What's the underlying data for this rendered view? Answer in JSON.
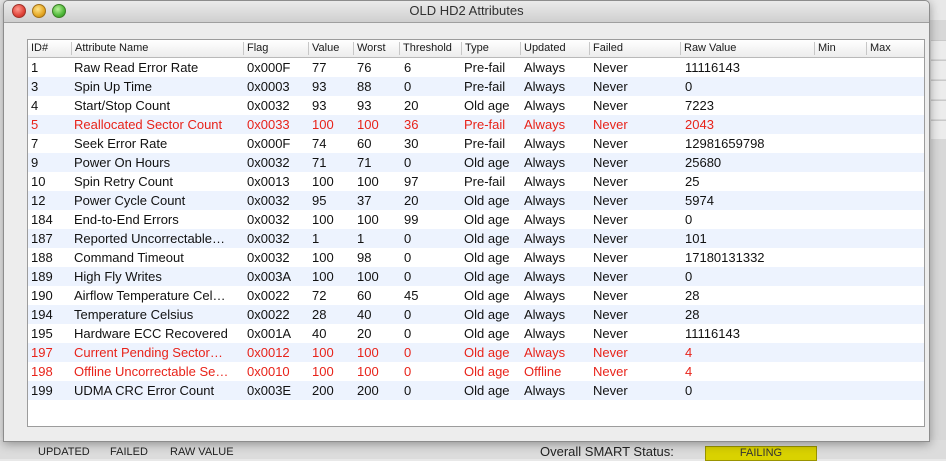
{
  "window": {
    "title": "OLD HD2 Attributes"
  },
  "columns": [
    "ID#",
    "Attribute Name",
    "Flag",
    "Value",
    "Worst",
    "Threshold",
    "Type",
    "Updated",
    "Failed",
    "Raw Value",
    "Min",
    "Max"
  ],
  "rows": [
    {
      "id": "1",
      "name": "Raw Read Error Rate",
      "flag": "0x000F",
      "value": "77",
      "worst": "76",
      "threshold": "6",
      "type": "Pre-fail",
      "updated": "Always",
      "failed": "Never",
      "raw": "11116143",
      "warn": false
    },
    {
      "id": "3",
      "name": "Spin Up Time",
      "flag": "0x0003",
      "value": "93",
      "worst": "88",
      "threshold": "0",
      "type": "Pre-fail",
      "updated": "Always",
      "failed": "Never",
      "raw": "0",
      "warn": false
    },
    {
      "id": "4",
      "name": "Start/Stop Count",
      "flag": "0x0032",
      "value": "93",
      "worst": "93",
      "threshold": "20",
      "type": "Old age",
      "updated": "Always",
      "failed": "Never",
      "raw": "7223",
      "warn": false
    },
    {
      "id": "5",
      "name": "Reallocated Sector Count",
      "flag": "0x0033",
      "value": "100",
      "worst": "100",
      "threshold": "36",
      "type": "Pre-fail",
      "updated": "Always",
      "failed": "Never",
      "raw": "2043",
      "warn": true
    },
    {
      "id": "7",
      "name": "Seek Error Rate",
      "flag": "0x000F",
      "value": "74",
      "worst": "60",
      "threshold": "30",
      "type": "Pre-fail",
      "updated": "Always",
      "failed": "Never",
      "raw": "12981659798",
      "warn": false
    },
    {
      "id": "9",
      "name": "Power On Hours",
      "flag": "0x0032",
      "value": "71",
      "worst": "71",
      "threshold": "0",
      "type": "Old age",
      "updated": "Always",
      "failed": "Never",
      "raw": "25680",
      "warn": false
    },
    {
      "id": "10",
      "name": "Spin Retry Count",
      "flag": "0x0013",
      "value": "100",
      "worst": "100",
      "threshold": "97",
      "type": "Pre-fail",
      "updated": "Always",
      "failed": "Never",
      "raw": "25",
      "warn": false
    },
    {
      "id": "12",
      "name": "Power Cycle Count",
      "flag": "0x0032",
      "value": "95",
      "worst": "37",
      "threshold": "20",
      "type": "Old age",
      "updated": "Always",
      "failed": "Never",
      "raw": "5974",
      "warn": false
    },
    {
      "id": "184",
      "name": "End-to-End Errors",
      "flag": "0x0032",
      "value": "100",
      "worst": "100",
      "threshold": "99",
      "type": "Old age",
      "updated": "Always",
      "failed": "Never",
      "raw": "0",
      "warn": false
    },
    {
      "id": "187",
      "name": "Reported Uncorrectable…",
      "flag": "0x0032",
      "value": "1",
      "worst": "1",
      "threshold": "0",
      "type": "Old age",
      "updated": "Always",
      "failed": "Never",
      "raw": "101",
      "warn": false
    },
    {
      "id": "188",
      "name": "Command Timeout",
      "flag": "0x0032",
      "value": "100",
      "worst": "98",
      "threshold": "0",
      "type": "Old age",
      "updated": "Always",
      "failed": "Never",
      "raw": "17180131332",
      "warn": false
    },
    {
      "id": "189",
      "name": "High Fly Writes",
      "flag": "0x003A",
      "value": "100",
      "worst": "100",
      "threshold": "0",
      "type": "Old age",
      "updated": "Always",
      "failed": "Never",
      "raw": "0",
      "warn": false
    },
    {
      "id": "190",
      "name": "Airflow Temperature Cel…",
      "flag": "0x0022",
      "value": "72",
      "worst": "60",
      "threshold": "45",
      "type": "Old age",
      "updated": "Always",
      "failed": "Never",
      "raw": "28",
      "warn": false
    },
    {
      "id": "194",
      "name": "Temperature Celsius",
      "flag": "0x0022",
      "value": "28",
      "worst": "40",
      "threshold": "0",
      "type": "Old age",
      "updated": "Always",
      "failed": "Never",
      "raw": "28",
      "warn": false
    },
    {
      "id": "195",
      "name": "Hardware ECC Recovered",
      "flag": "0x001A",
      "value": "40",
      "worst": "20",
      "threshold": "0",
      "type": "Old age",
      "updated": "Always",
      "failed": "Never",
      "raw": "11116143",
      "warn": false
    },
    {
      "id": "197",
      "name": "Current Pending Sector…",
      "flag": "0x0012",
      "value": "100",
      "worst": "100",
      "threshold": "0",
      "type": "Old age",
      "updated": "Always",
      "failed": "Never",
      "raw": "4",
      "warn": true
    },
    {
      "id": "198",
      "name": "Offline Uncorrectable Se…",
      "flag": "0x0010",
      "value": "100",
      "worst": "100",
      "threshold": "0",
      "type": "Old age",
      "updated": "Offline",
      "failed": "Never",
      "raw": "4",
      "warn": true
    },
    {
      "id": "199",
      "name": "UDMA CRC Error Count",
      "flag": "0x003E",
      "value": "200",
      "worst": "200",
      "threshold": "0",
      "type": "Old age",
      "updated": "Always",
      "failed": "Never",
      "raw": "0",
      "warn": false
    }
  ],
  "background": {
    "labels": [
      "UPDATED",
      "FAILED",
      "RAW VALUE"
    ],
    "status_label": "Overall SMART Status:",
    "status_value": "FAILING"
  },
  "colors": {
    "warn": "#e8231a",
    "row_alt": "#edf3fe"
  }
}
